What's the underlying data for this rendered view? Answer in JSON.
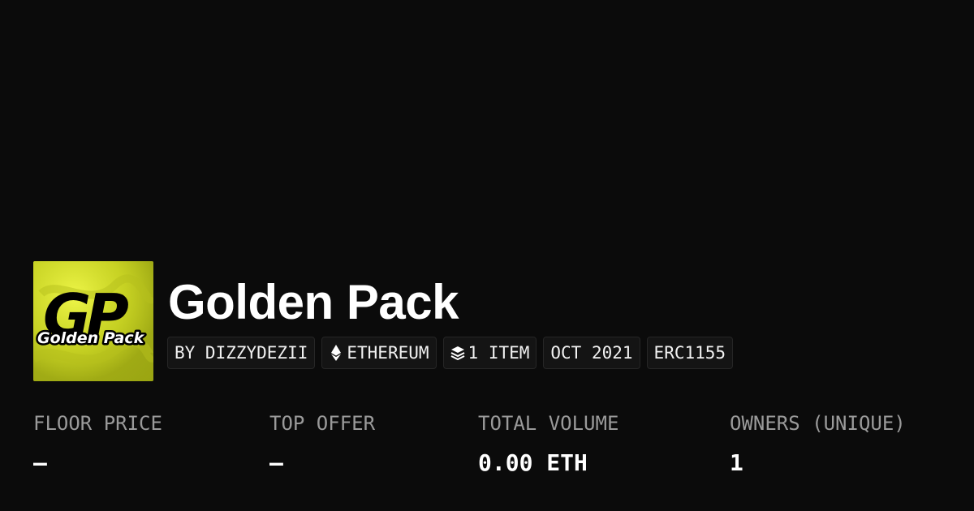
{
  "collection": {
    "title": "Golden Pack",
    "logo": {
      "alt_text": "Golden Pack",
      "monogram": "GP",
      "colors": {
        "background": "#cdd72a",
        "ink": "#000000"
      }
    }
  },
  "badges": {
    "creator": "BY DIZZYDEZII",
    "chain": {
      "icon": "ethereum-icon",
      "label": "ETHEREUM"
    },
    "items": {
      "icon": "layers-icon",
      "label": "1 ITEM"
    },
    "date": "OCT 2021",
    "standard": "ERC1155"
  },
  "stats": {
    "floor_price": {
      "label": "FLOOR PRICE",
      "value": "–"
    },
    "top_offer": {
      "label": "TOP OFFER",
      "value": "–"
    },
    "total_volume": {
      "label": "TOTAL VOLUME",
      "value": "0.00 ETH"
    },
    "owners": {
      "label": "OWNERS (UNIQUE)",
      "value": "1"
    }
  },
  "theme": {
    "background": "#0b0b0b",
    "text": "#ffffff",
    "muted": "#9a9a9a",
    "badge_bg": "#141414"
  }
}
